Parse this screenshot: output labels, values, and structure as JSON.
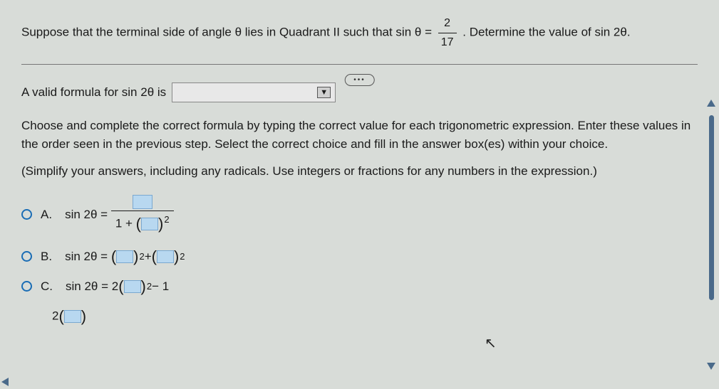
{
  "question": {
    "prefix": "Suppose that the terminal side of angle θ lies in Quadrant II such that sin θ =",
    "frac_num": "2",
    "frac_den": "17",
    "suffix": ". Determine the value of sin 2θ."
  },
  "formula_line": {
    "label": "A valid formula for sin 2θ is"
  },
  "instructions": "Choose and complete the correct formula by typing the correct value for each trigonometric expression. Enter these values in the order seen in the previous step. Select the correct choice and fill in the answer box(es) within your choice.",
  "simplify": "(Simplify your answers, including any radicals. Use integers or fractions for any numbers in the expression.)",
  "choices": {
    "a": {
      "label": "A.",
      "expr_prefix": "sin 2θ =",
      "den_prefix": "1 + "
    },
    "b": {
      "label": "B.",
      "expr_prefix": "sin 2θ =",
      "plus": " + "
    },
    "c": {
      "label": "C.",
      "expr_prefix": "sin 2θ = 2",
      "suffix": " − 1"
    },
    "d_partial": "2"
  },
  "sup2": "2"
}
